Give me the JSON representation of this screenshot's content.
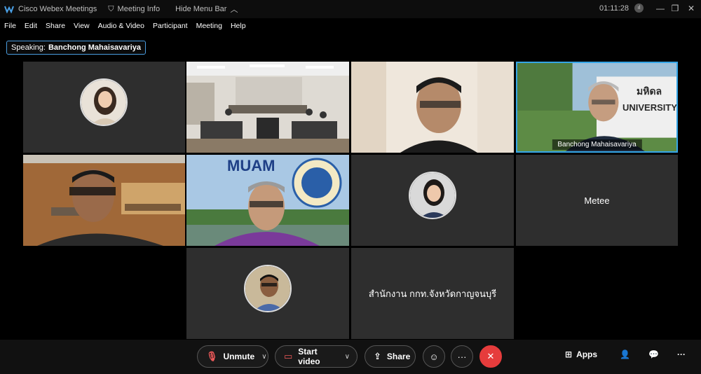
{
  "titlebar": {
    "app_title": "Cisco Webex Meetings",
    "meeting_info": "Meeting Info",
    "hide_menu_bar": "Hide Menu Bar",
    "timer": "01:11:28"
  },
  "menu": {
    "items": [
      "File",
      "Edit",
      "Share",
      "View",
      "Audio & Video",
      "Participant",
      "Meeting",
      "Help"
    ]
  },
  "speaking": {
    "label": "Speaking:",
    "name": "Banchong Mahaisavariya"
  },
  "tiles": {
    "active_name": "Banchong Mahaisavariya",
    "metee": "Metee",
    "office_name": "สำนักงาน กกท.จังหวัดกาญจนบุรี",
    "muam_banner": "MUAM",
    "backdrop_text": "UNIVERSITY",
    "backdrop_thai": "มหิดล"
  },
  "toolbar": {
    "unmute": "Unmute",
    "start_video": "Start video",
    "share": "Share",
    "more": "···",
    "apps": "Apps",
    "overflow": "···"
  },
  "colors": {
    "active_border": "#35a6e8",
    "end_button": "#e63c3c",
    "tile_bg": "#2e2e2e"
  }
}
